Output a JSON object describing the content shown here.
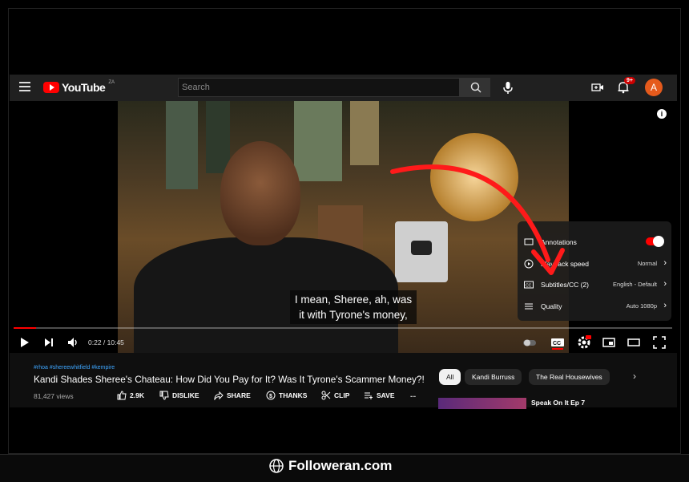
{
  "header": {
    "logo_word": "YouTube",
    "region": "ZA",
    "search_placeholder": "Search",
    "notification_count": "9+",
    "avatar_letter": "A"
  },
  "video": {
    "subtitle_line1": "I mean, Sheree, ah, was",
    "subtitle_line2": "it with Tyrone's money,",
    "time": "0:22 / 10:45",
    "progress": 0.034
  },
  "settings_menu": {
    "items": [
      {
        "label": "Annotations",
        "value": "",
        "type": "toggle"
      },
      {
        "label": "Playback speed",
        "value": "Normal",
        "type": "submenu"
      },
      {
        "label": "Subtitles/CC (2)",
        "value": "English - Default",
        "type": "submenu"
      },
      {
        "label": "Quality",
        "value": "Auto 1080p",
        "type": "submenu"
      }
    ]
  },
  "info": {
    "hashtags": "#rhoa #shereewhitfield #kempire",
    "title": "Kandi Shades Sheree's Chateau: How Did You Pay for It? Was It Tyrone's Scammer Money?!",
    "views": "81,427 views",
    "actions": {
      "like": "2.9K",
      "dislike": "DISLIKE",
      "share": "SHARE",
      "thanks": "THANKS",
      "clip": "CLIP",
      "save": "SAVE",
      "more": "..."
    }
  },
  "chips": [
    "All",
    "Kandi Burruss",
    "The Real Housewives"
  ],
  "recommended": {
    "title": "Speak On It Ep 7"
  },
  "watermark": {
    "text": "Followeran.com"
  },
  "colors": {
    "accent": "#ff0000",
    "link": "#3ea6ff",
    "header_bg": "#202020"
  }
}
